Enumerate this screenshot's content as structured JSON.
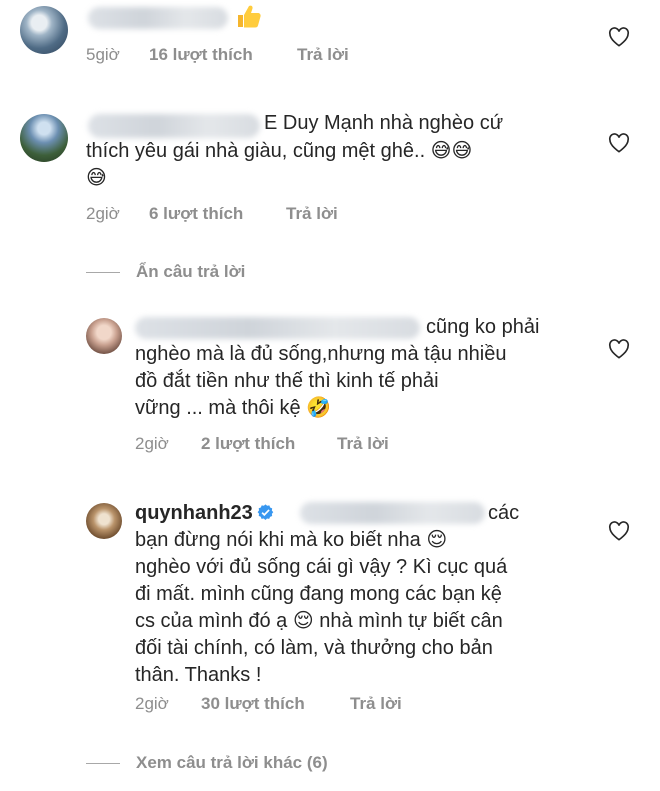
{
  "comments": [
    {
      "text_lines": [
        "👍"
      ],
      "meta": {
        "time": "5giờ",
        "likes": "16 lượt thích",
        "reply": "Trả lời"
      }
    },
    {
      "text_lines": [
        "E Duy Mạnh nhà nghèo cứ",
        "thích yêu gái nhà giàu, cũng mệt ghê.. 😅😅",
        "😅"
      ],
      "meta": {
        "time": "2giờ",
        "likes": "6 lượt thích",
        "reply": "Trả lời"
      }
    }
  ],
  "hide_replies": "Ẩn câu trả lời",
  "replies": [
    {
      "text_lines": [
        "cũng ko phải",
        "nghèo mà là đủ sống,nhưng mà tậu nhiều",
        "đồ đắt tiền như thế thì kinh tế phải",
        "vững ... mà thôi kệ 🤣"
      ],
      "meta": {
        "time": "2giờ",
        "likes": "2 lượt thích",
        "reply": "Trả lời"
      }
    },
    {
      "username": "quynhanh23",
      "text_lines": [
        "các",
        "bạn đừng nói khi mà ko biết nha 😌",
        "nghèo với đủ sống cái gì vậy ? Kì cục quá",
        "đi mất. mình cũng đang mong các bạn kệ",
        "cs của mình đó ạ 😌 nhà mình tự biết cân",
        "đối tài chính, có làm, và thưởng cho bản",
        "thân. Thanks !"
      ],
      "meta": {
        "time": "2giờ",
        "likes": "30 lượt thích",
        "reply": "Trả lời"
      }
    }
  ],
  "view_more_replies": "Xem câu trả lời khác (6)",
  "icons": {
    "like": "heart-outline-icon",
    "verified": "verified-badge-icon",
    "thumbs_up": "thumbs-up-emoji",
    "sweat_smile": "grinning-sweat-emoji",
    "rofl": "rolling-laughing-emoji",
    "relieved": "relieved-face-emoji"
  },
  "colors": {
    "text": "#262626",
    "meta": "#8e8e8e",
    "verified": "#3897f0"
  }
}
